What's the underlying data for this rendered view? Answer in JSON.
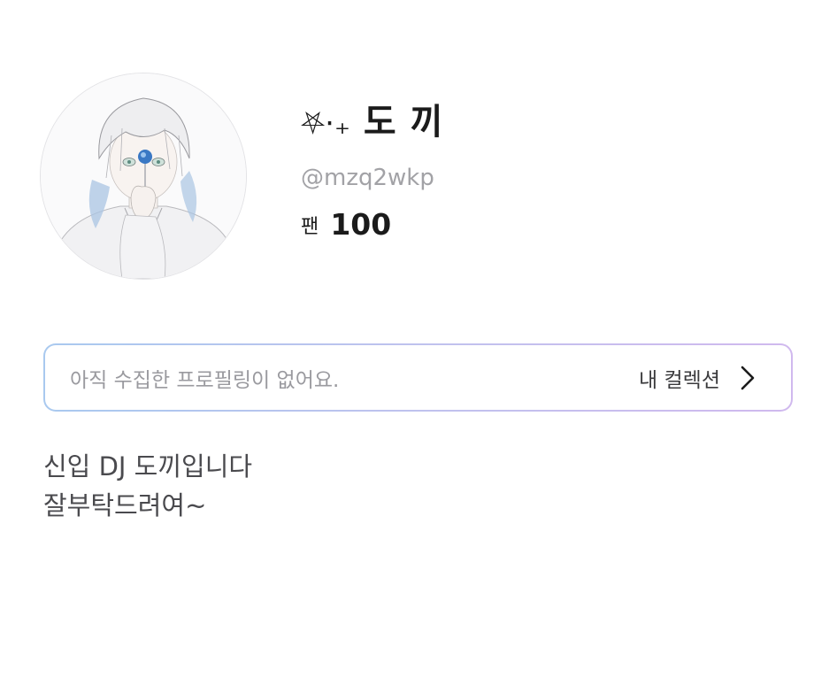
{
  "profile": {
    "avatar_icon": "avatar-illustration",
    "name_decoration": "⛧⋅₊",
    "name": "도 끼",
    "handle": "@mzq2wkp",
    "fans_label": "팬",
    "fans_count": "100"
  },
  "collection": {
    "empty_text": "아직 수집한 프로필링이 없어요.",
    "link_label": "내 컬렉션",
    "chevron_icon": "chevron-right-icon",
    "border_colors": [
      "#a9c9ef",
      "#d0b9ee"
    ]
  },
  "bio": {
    "line1": "신입 DJ 도끼입니다",
    "line2": "잘부탁드려여~"
  }
}
